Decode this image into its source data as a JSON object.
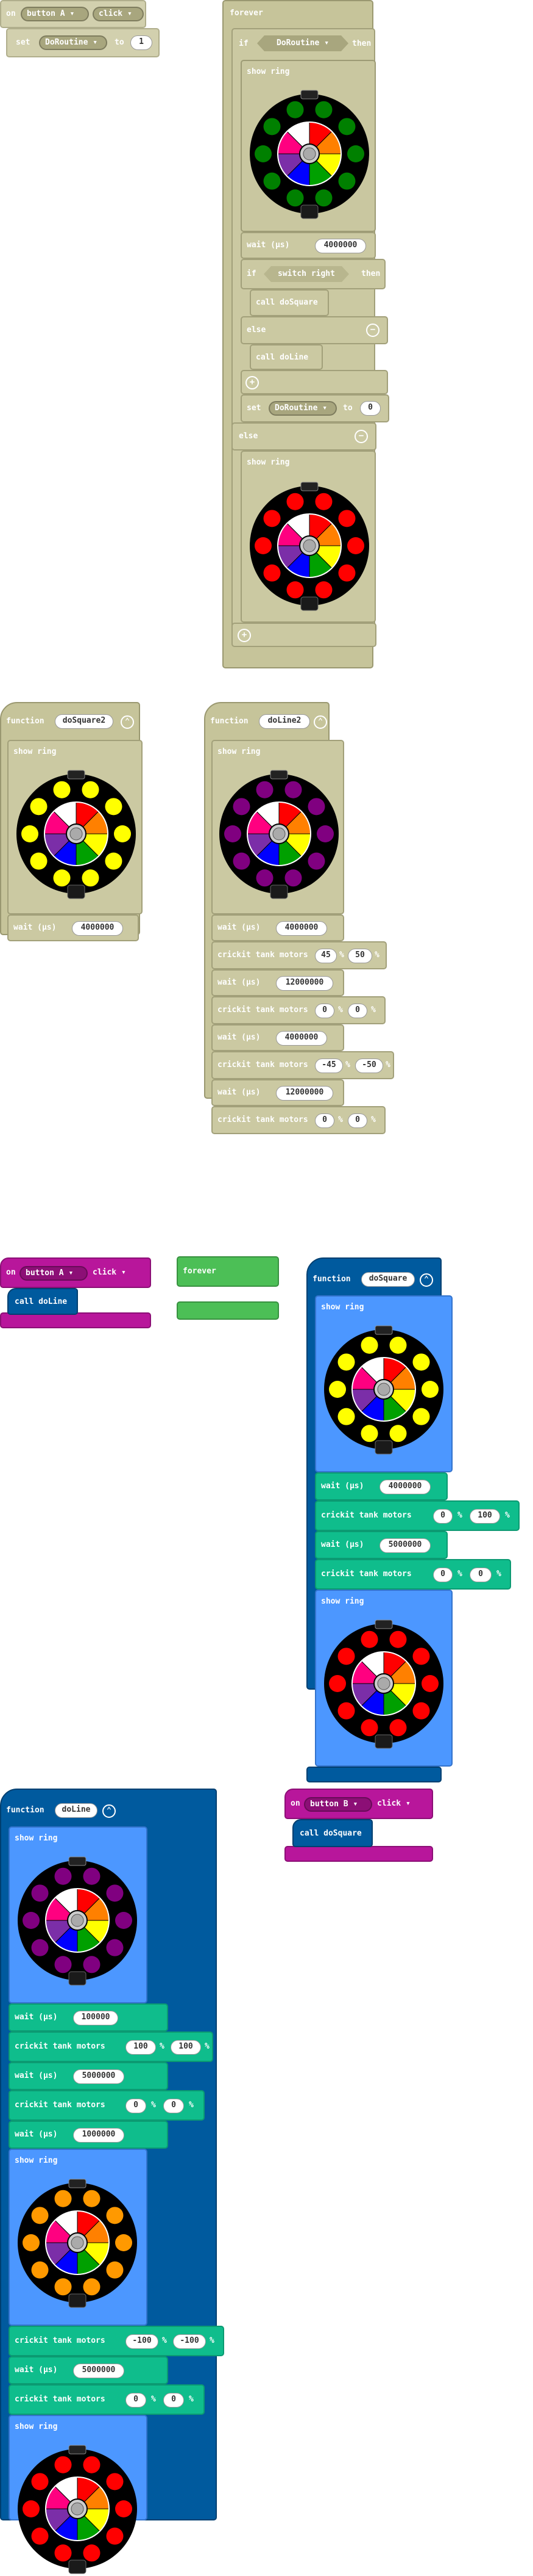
{
  "colors": {
    "khaki": "#c6c49a",
    "function_blue": "#005a9e",
    "light_blue": "#4c97ff",
    "crickit_green": "#0fbd8c",
    "event_magenta": "#b8169b",
    "loop_green": "#4cbf56"
  },
  "labels": {
    "on": "on",
    "set": "set",
    "to": "to",
    "forever": "forever",
    "if": "if",
    "then": "then",
    "else": "else",
    "show_ring": "show ring",
    "wait_us": "wait (µs)",
    "call": "call",
    "function": "function",
    "crickit": "crickit tank motors",
    "pct": "%"
  },
  "icons": {
    "collapse": "⌃",
    "plus": "+",
    "minus": "−",
    "caret": "▾"
  },
  "blocks": {
    "on_button_a_disabled": {
      "button": "button A",
      "event": "click"
    },
    "set_doroutine_1": {
      "variable": "DoRoutine",
      "value": "1"
    },
    "forever_main": {
      "if_condition": "DoRoutine",
      "wait_value": "4000000",
      "elseif_condition": "switch right",
      "call_1": "doSquare",
      "call_2": "doLine",
      "set_variable": "DoRoutine",
      "set_value": "0"
    },
    "function_dosquare2": {
      "name": "doSquare2",
      "wait_value": "4000000"
    },
    "function_doline2": {
      "name": "doLine2",
      "waits": [
        "4000000",
        "12000000",
        "4000000",
        "12000000"
      ],
      "motors": [
        [
          "45",
          "50"
        ],
        [
          "0",
          "0"
        ],
        [
          "-45",
          "-50"
        ],
        [
          "0",
          "0"
        ]
      ]
    },
    "on_button_a": {
      "button": "button A",
      "event": "click",
      "call": "doLine"
    },
    "forever_empty": {
      "label": "forever"
    },
    "function_dosquare": {
      "name": "doSquare",
      "waits": [
        "4000000",
        "5000000"
      ],
      "motors": [
        [
          "0",
          "100"
        ],
        [
          "0",
          "0"
        ]
      ]
    },
    "function_doline": {
      "name": "doLine",
      "waits": [
        "100000",
        "5000000",
        "1000000",
        "5000000"
      ],
      "motors": [
        [
          "100",
          "100"
        ],
        [
          "0",
          "0"
        ],
        [
          "-100",
          "-100"
        ],
        [
          "0",
          "0"
        ]
      ]
    },
    "on_button_b": {
      "button": "button B",
      "event": "click",
      "call": "doSquare"
    }
  },
  "ring_outer_colors": {
    "green": "#008000",
    "red": "#ff0000",
    "yellow": "#ffff00",
    "purple": "#800080",
    "orange": "#ff9900"
  },
  "ring_inner_segments": [
    "#ff0000",
    "#ff8000",
    "#ffff00",
    "#00a000",
    "#0000ff",
    "#7b2ea8",
    "#ff0080",
    "#ffffff"
  ]
}
